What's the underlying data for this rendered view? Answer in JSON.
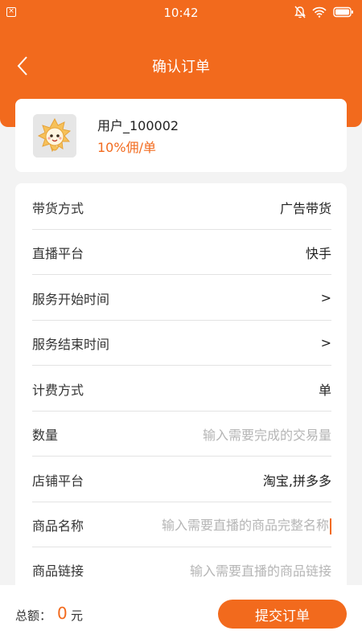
{
  "status_bar": {
    "time": "10:42",
    "left_icon": "close-box-icon",
    "right_icons": [
      "mute-bell-icon",
      "wifi-icon",
      "battery-icon"
    ]
  },
  "nav": {
    "title": "确认订单",
    "back_icon": "chevron-left-icon"
  },
  "user": {
    "name": "用户_100002",
    "commission": "10%佣/单",
    "avatar_icon": "cartoon-sun-avatar"
  },
  "form": {
    "rows": [
      {
        "label": "带货方式",
        "value": "广告带货"
      },
      {
        "label": "直播平台",
        "value": "快手"
      },
      {
        "label": "服务开始时间",
        "value": ">"
      },
      {
        "label": "服务结束时间",
        "value": ">"
      },
      {
        "label": "计费方式",
        "value": "单"
      },
      {
        "label": "数量",
        "placeholder": "输入需要完成的交易量"
      },
      {
        "label": "店铺平台",
        "value": "淘宝,拼多多"
      },
      {
        "label": "商品名称",
        "placeholder": "输入需要直播的商品完整名称"
      },
      {
        "label": "商品链接",
        "placeholder": "输入需要直播的商品链接"
      }
    ]
  },
  "bottom": {
    "total_label": "总额：",
    "total_value": "0",
    "total_unit": "元",
    "submit_label": "提交订单"
  },
  "colors": {
    "accent": "#f26a1d",
    "background": "#f3f3f3",
    "placeholder": "#b5b5b5"
  }
}
